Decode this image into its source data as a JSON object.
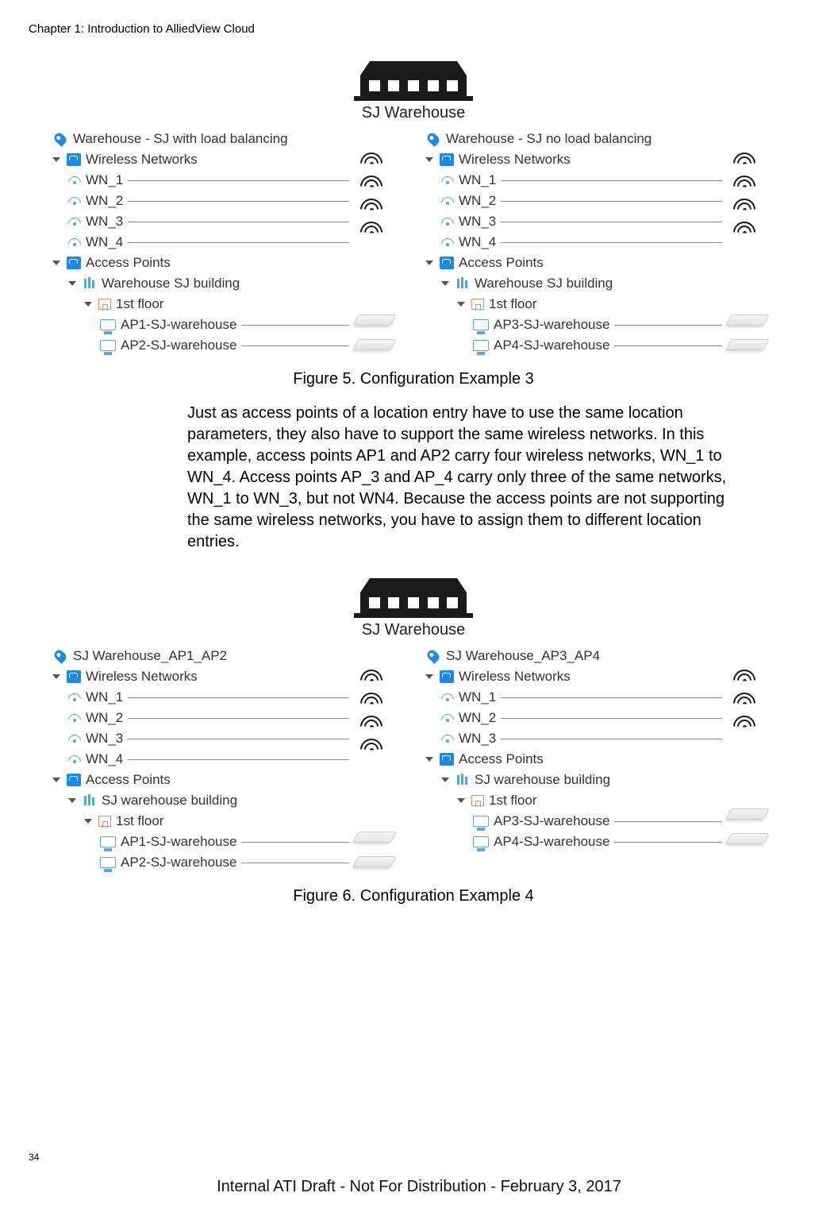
{
  "header": {
    "chapter_title": "Chapter 1: Introduction to AlliedView Cloud"
  },
  "page_number": "34",
  "footer": "Internal ATI Draft - Not For Distribution - February 3, 2017",
  "warehouse_label": "SJ Warehouse",
  "figure5": {
    "caption": "Figure 5. Configuration Example 3",
    "left": {
      "location": "Warehouse - SJ with load balancing",
      "wn_section": "Wireless Networks",
      "wn": [
        "WN_1",
        "WN_2",
        "WN_3",
        "WN_4"
      ],
      "ap_section": "Access Points",
      "building": "Warehouse SJ building",
      "floor": "1st floor",
      "aps": [
        "AP1-SJ-warehouse",
        "AP2-SJ-warehouse"
      ]
    },
    "right": {
      "location": "Warehouse - SJ no load balancing",
      "wn_section": "Wireless Networks",
      "wn": [
        "WN_1",
        "WN_2",
        "WN_3",
        "WN_4"
      ],
      "ap_section": "Access Points",
      "building": "Warehouse SJ building",
      "floor": "1st floor",
      "aps": [
        "AP3-SJ-warehouse",
        "AP4-SJ-warehouse"
      ]
    }
  },
  "paragraph": "Just as access points of a location entry have to use the same location parameters, they also have to support the same wireless networks. In this example, access points AP1 and AP2 carry four wireless networks, WN_1 to WN_4. Access points AP_3 and AP_4 carry only three of the same networks, WN_1 to WN_3, but not WN4. Because the access points are not supporting the same wireless networks, you have to assign them to different location entries.",
  "figure6": {
    "caption": "Figure 6. Configuration Example 4",
    "left": {
      "location": "SJ Warehouse_AP1_AP2",
      "wn_section": "Wireless Networks",
      "wn": [
        "WN_1",
        "WN_2",
        "WN_3",
        "WN_4"
      ],
      "ap_section": "Access Points",
      "building": "SJ warehouse building",
      "floor": "1st floor",
      "aps": [
        "AP1-SJ-warehouse",
        "AP2-SJ-warehouse"
      ]
    },
    "right": {
      "location": "SJ Warehouse_AP3_AP4",
      "wn_section": "Wireless Networks",
      "wn": [
        "WN_1",
        "WN_2",
        "WN_3"
      ],
      "ap_section": "Access Points",
      "building": "SJ warehouse building",
      "floor": "1st floor",
      "aps": [
        "AP3-SJ-warehouse",
        "AP4-SJ-warehouse"
      ]
    }
  }
}
